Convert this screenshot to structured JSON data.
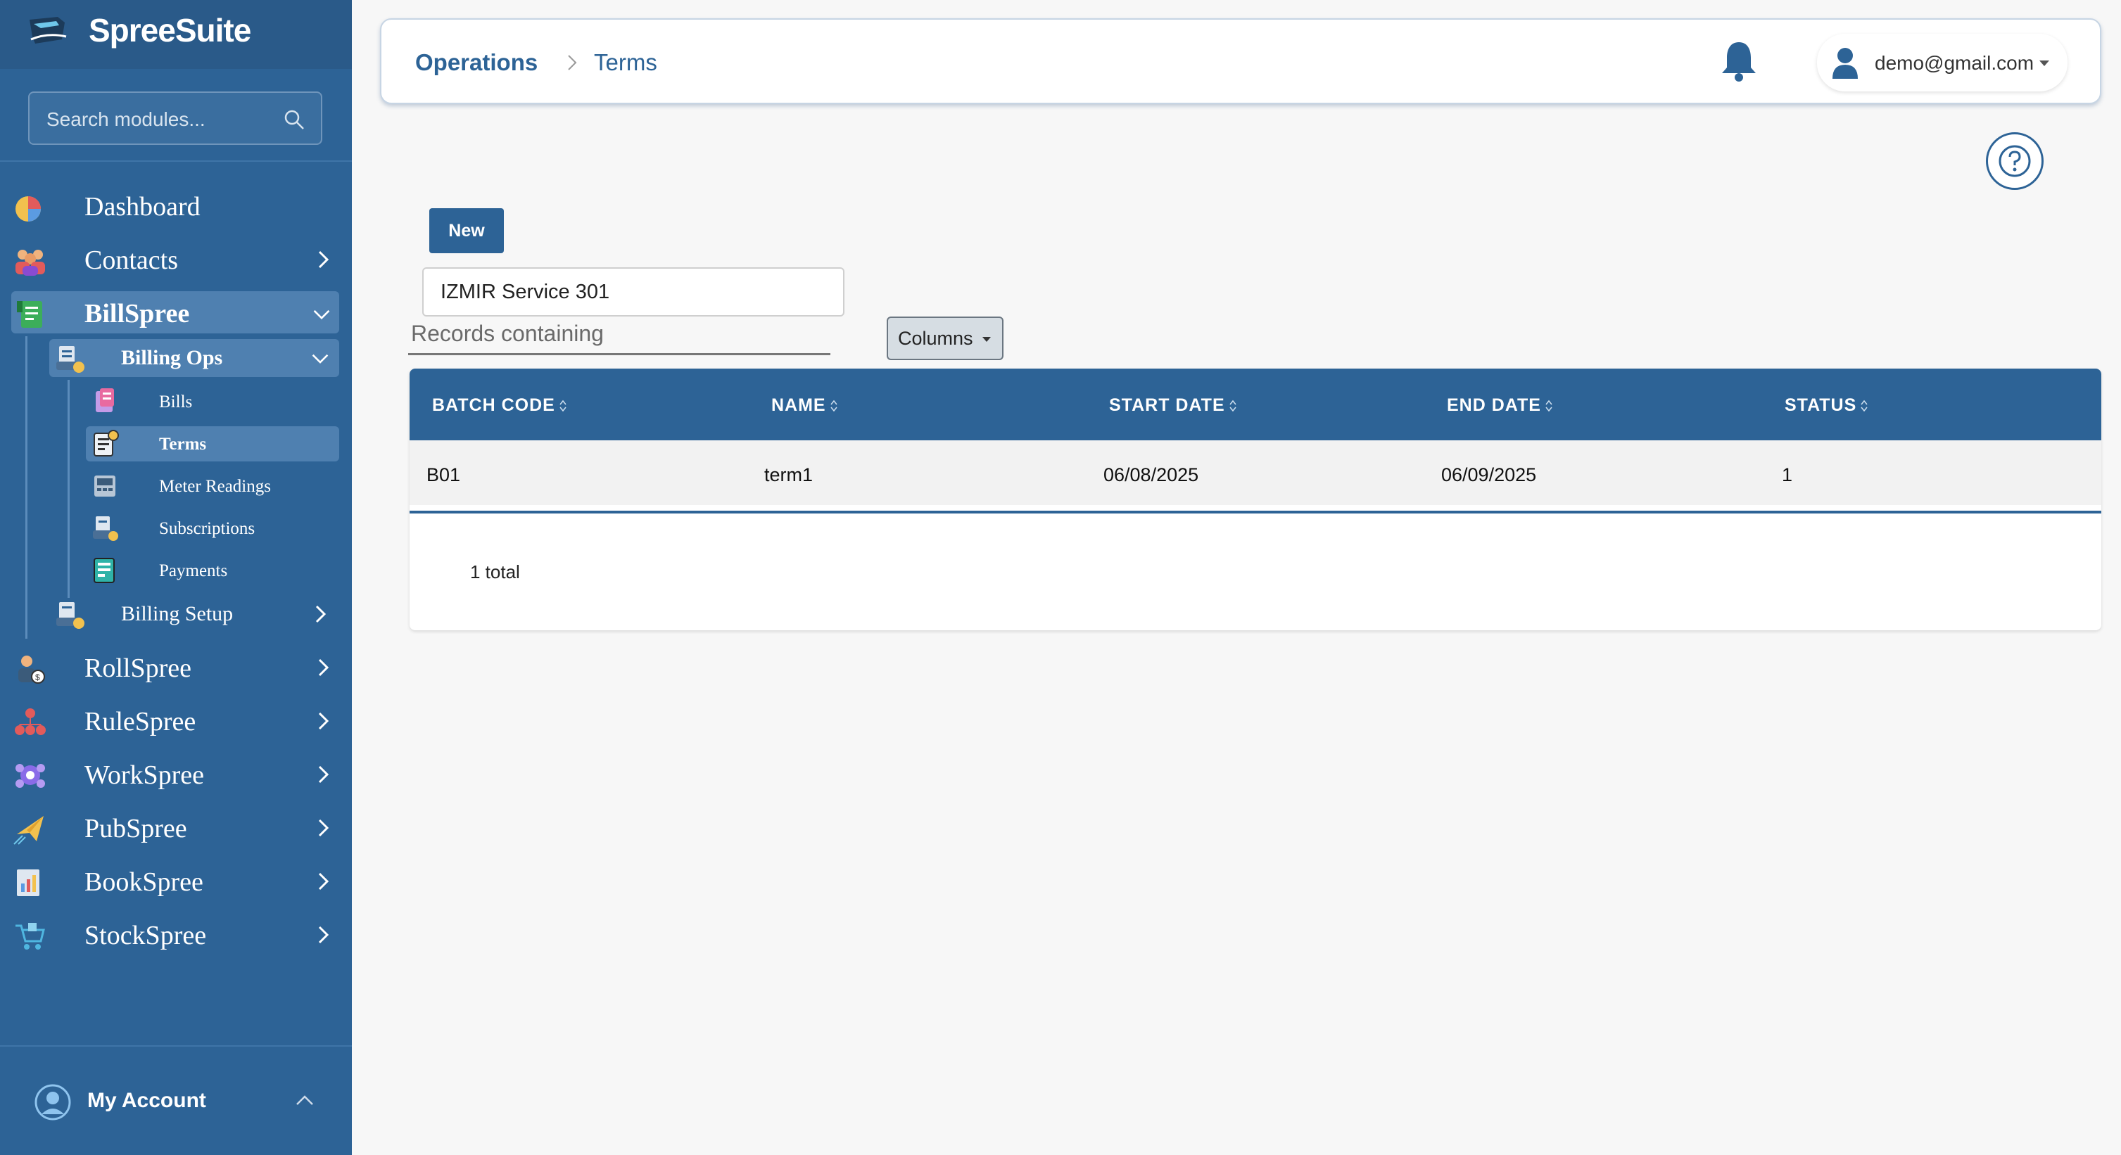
{
  "app": {
    "name": "SpreeSuite"
  },
  "sidebar": {
    "search_placeholder": "Search modules...",
    "items": [
      {
        "label": "Dashboard",
        "icon": "chart-pie-icon"
      },
      {
        "label": "Contacts",
        "icon": "people-icon"
      },
      {
        "label": "BillSpree",
        "icon": "ledger-icon"
      },
      {
        "label": "RollSpree",
        "icon": "payroll-icon"
      },
      {
        "label": "RuleSpree",
        "icon": "hierarchy-icon"
      },
      {
        "label": "WorkSpree",
        "icon": "team-icon"
      },
      {
        "label": "PubSpree",
        "icon": "paper-plane-icon"
      },
      {
        "label": "BookSpree",
        "icon": "report-icon"
      },
      {
        "label": "StockSpree",
        "icon": "cart-icon"
      }
    ],
    "billspree": {
      "billing_ops": "Billing Ops",
      "ops_items": [
        "Bills",
        "Terms",
        "Meter Readings",
        "Subscriptions",
        "Payments"
      ],
      "billing_setup": "Billing Setup"
    },
    "account_label": "My Account"
  },
  "header": {
    "crumbs": [
      "Operations",
      "Terms"
    ],
    "user_email": "demo@gmail.com"
  },
  "toolbar": {
    "new_label": "New",
    "filter_value": "IZMIR Service 301",
    "filter_label": "Records containing",
    "columns_label": "Columns"
  },
  "table": {
    "columns": [
      "BATCH CODE",
      "NAME",
      "START DATE",
      "END DATE",
      "STATUS"
    ],
    "rows": [
      [
        "B01",
        "term1",
        "06/08/2025",
        "06/09/2025",
        "1"
      ]
    ],
    "total_text": "1 total"
  },
  "colors": {
    "brand": "#2d6396",
    "sidebar_active": "#4f80b0",
    "background": "#f7f7f7"
  }
}
